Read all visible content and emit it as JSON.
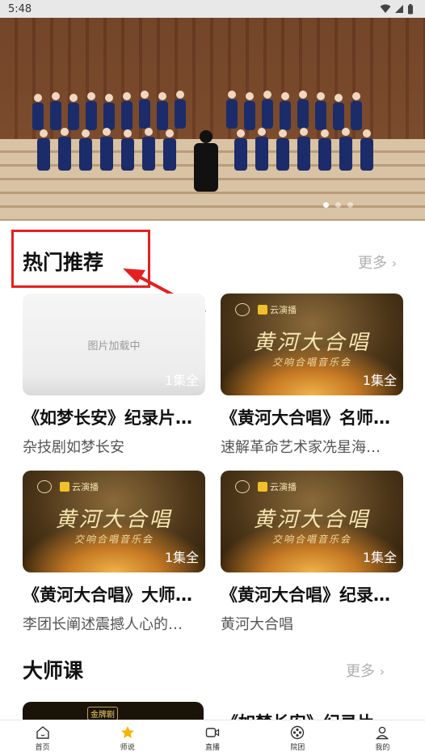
{
  "status_bar": {
    "time": "5:48"
  },
  "hot_section": {
    "title": "热门推荐",
    "more": "更多"
  },
  "cards": [
    {
      "thumb_text": "图片加载中",
      "episodes": "1集全",
      "title": "《如梦长安》纪录片…",
      "subtitle": "杂技剧如梦长安"
    },
    {
      "art_title": "黄河大合唱",
      "art_subtitle": "交响合唱音乐会",
      "brand": "云演播",
      "episodes": "1集全",
      "title": "《黄河大合唱》名师…",
      "subtitle": "速解革命艺术家冼星海…"
    },
    {
      "art_title": "黄河大合唱",
      "art_subtitle": "交响合唱音乐会",
      "brand": "云演播",
      "episodes": "1集全",
      "title": "《黄河大合唱》大师…",
      "subtitle": "李团长阐述震撼人心的…"
    },
    {
      "art_title": "黄河大合唱",
      "art_subtitle": "交响合唱音乐会",
      "brand": "云演播",
      "episodes": "1集全",
      "title": "《黄河大合唱》纪录…",
      "subtitle": "黄河大合唱"
    }
  ],
  "master_section": {
    "title": "大师课",
    "more": "更多",
    "peek_badge": "金牌剧",
    "peek_title": "《如梦长安》纪录片…"
  },
  "tabbar": {
    "items": [
      {
        "label": "首页",
        "icon": "home-icon"
      },
      {
        "label": "师说",
        "icon": "star-icon",
        "active": true
      },
      {
        "label": "直播",
        "icon": "video-icon"
      },
      {
        "label": "院团",
        "icon": "film-reel-icon"
      },
      {
        "label": "我的",
        "icon": "person-icon"
      }
    ]
  },
  "colors": {
    "highlight": "#e52020",
    "accent": "#f5b400",
    "more_text": "#b0b0b0"
  }
}
